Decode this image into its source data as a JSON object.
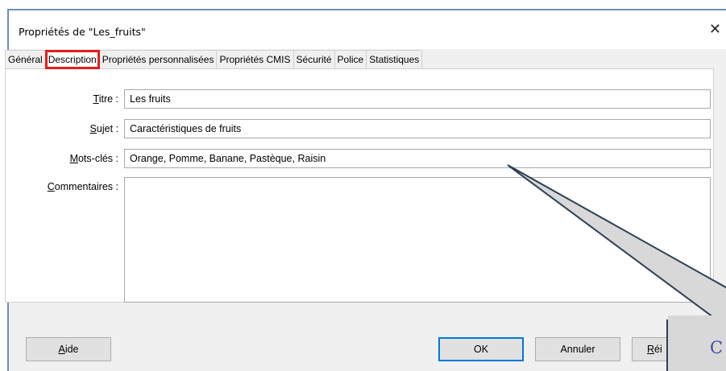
{
  "window": {
    "title": "Propriétés de \"Les_fruits\"",
    "close_glyph": "✕"
  },
  "tabs": [
    {
      "label": "Général"
    },
    {
      "label": "Description"
    },
    {
      "label": "Propriétés personnalisées"
    },
    {
      "label": "Propriétés CMIS"
    },
    {
      "label": "Sécurité"
    },
    {
      "label": "Police"
    },
    {
      "label": "Statistiques"
    }
  ],
  "active_tab": "Description",
  "form": {
    "titre": {
      "label_mnemonic": "T",
      "label_rest": "itre :",
      "value": "Les fruits"
    },
    "sujet": {
      "label_mnemonic": "S",
      "label_rest": "ujet :",
      "value": "Caractéristiques de fruits"
    },
    "mots_cles": {
      "label_mnemonic": "M",
      "label_rest": "ots-clés :",
      "value": "Orange, Pomme, Banane, Pastèque, Raisin"
    },
    "commentaires": {
      "label_mnemonic": "C",
      "label_rest": "ommentaires :",
      "value": ""
    }
  },
  "buttons": {
    "aide_mnemonic": "A",
    "aide_rest": "ide",
    "ok": "OK",
    "annuler": "Annuler",
    "reinit_mnemonic": "R",
    "reinit_rest": "éi"
  },
  "callout": {
    "text": "C"
  },
  "colors": {
    "highlight": "#e0201c",
    "default_button_border": "#0078d7",
    "callout_fill": "#d8d8d8",
    "callout_stroke": "#2d4054",
    "callout_text": "#3a4f9e"
  }
}
